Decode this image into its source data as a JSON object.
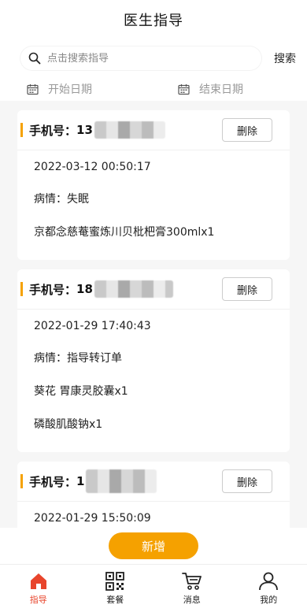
{
  "header": {
    "title": "医生指导"
  },
  "search": {
    "placeholder": "点击搜索指导",
    "button_label": "搜索"
  },
  "dates": {
    "start_placeholder": "开始日期",
    "end_placeholder": "结束日期"
  },
  "cards": [
    {
      "phone_label": "手机号：",
      "phone_visible": "13",
      "delete_label": "删除",
      "lines": [
        "2022-03-12 00:50:17",
        "病情：失眠",
        "京都念慈菴蜜炼川贝枇杷膏300mlx1"
      ]
    },
    {
      "phone_label": "手机号：",
      "phone_visible": "18",
      "delete_label": "删除",
      "lines": [
        "2022-01-29 17:40:43",
        "病情：指导转订单",
        "葵花 胃康灵胶囊x1",
        "磷酸肌酸钠x1"
      ]
    },
    {
      "phone_label": "手机号：",
      "phone_visible": "1",
      "delete_label": "删除",
      "lines": [
        "2022-01-29 15:50:09"
      ]
    }
  ],
  "add_button": {
    "label": "新增"
  },
  "tabbar": {
    "accent_color": "#e8452c",
    "items": [
      {
        "label": "指导",
        "icon": "home-icon",
        "active": true
      },
      {
        "label": "套餐",
        "icon": "qrcode-icon",
        "active": false
      },
      {
        "label": "消息",
        "icon": "cart-icon",
        "active": false
      },
      {
        "label": "我的",
        "icon": "user-icon",
        "active": false
      }
    ]
  }
}
